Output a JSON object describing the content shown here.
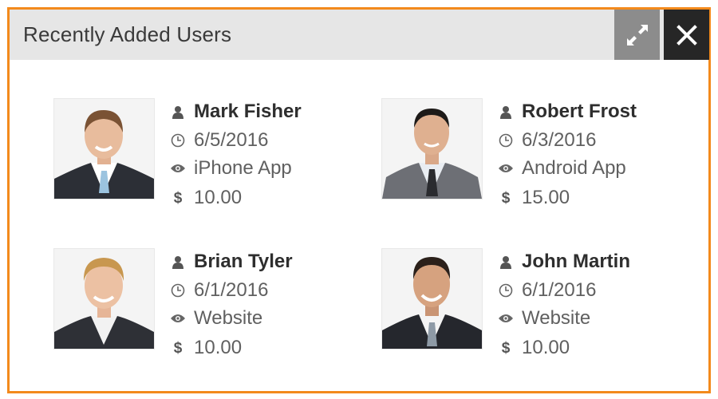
{
  "widget": {
    "title": "Recently Added Users",
    "accent_color": "#f38a1c",
    "expand_icon": "expand-arrows-icon",
    "close_icon": "close-x-icon"
  },
  "users": [
    {
      "name": "Mark Fisher",
      "date": "6/5/2016",
      "source": "iPhone App",
      "amount": "10.00"
    },
    {
      "name": "Robert Frost",
      "date": "6/3/2016",
      "source": "Android App",
      "amount": "15.00"
    },
    {
      "name": "Brian Tyler",
      "date": "6/1/2016",
      "source": "Website",
      "amount": "10.00"
    },
    {
      "name": "John Martin",
      "date": "6/1/2016",
      "source": "Website",
      "amount": "10.00"
    }
  ],
  "icons": {
    "name": "user-icon",
    "date": "clock-icon",
    "source": "eye-icon",
    "amount": "dollar-icon",
    "dollar_glyph": "$"
  }
}
